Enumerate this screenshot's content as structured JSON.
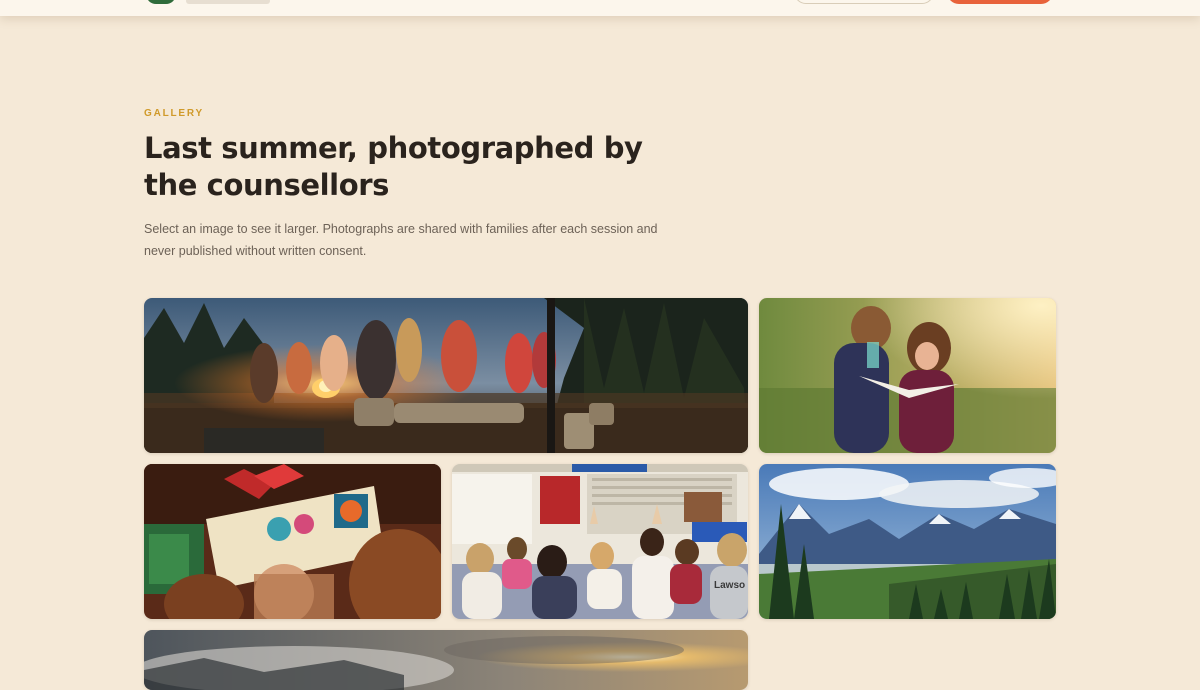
{
  "header": {
    "logo_icon": "leaf-logo-icon"
  },
  "gallery": {
    "eyebrow": "GALLERY",
    "title": "Last summer, photographed by the counsellors",
    "description": "Select an image to see it larger. Photographs are shared with families after each session and never published without written consent.",
    "photos": [
      {
        "subject": "campfire-at-dusk",
        "alt": ""
      },
      {
        "subject": "children-reading-in-meadow",
        "alt": ""
      },
      {
        "subject": "children-reading-picture-book",
        "alt": ""
      },
      {
        "subject": "classroom-hands-raised",
        "alt": "",
        "shirt_text": "Lawso"
      },
      {
        "subject": "mountain-valley-landscape",
        "alt": ""
      },
      {
        "subject": "sunset-over-clouds",
        "alt": ""
      }
    ]
  },
  "colors": {
    "background": "#f5e9d7",
    "eyebrow": "#d09a2a",
    "title": "#2a231d",
    "cta": "#e8623a"
  }
}
